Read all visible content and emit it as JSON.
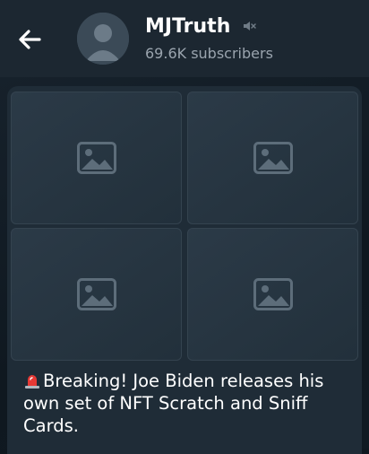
{
  "header": {
    "channel_title": "MJTruth",
    "subscriber_count": "69.6K subscribers",
    "icons": {
      "back": "arrow-left-icon",
      "mute": "muted-speaker-icon"
    }
  },
  "message": {
    "text": "Breaking! Joe Biden releases his own set of NFT Scratch and Sniff Cards.",
    "leading_emoji": "siren-icon",
    "photo_count": 4
  },
  "colors": {
    "header_bg": "#1c2731",
    "chat_bg": "#0f1820",
    "bubble_bg": "#1f2c37",
    "muted_text": "#9aa4ae"
  }
}
